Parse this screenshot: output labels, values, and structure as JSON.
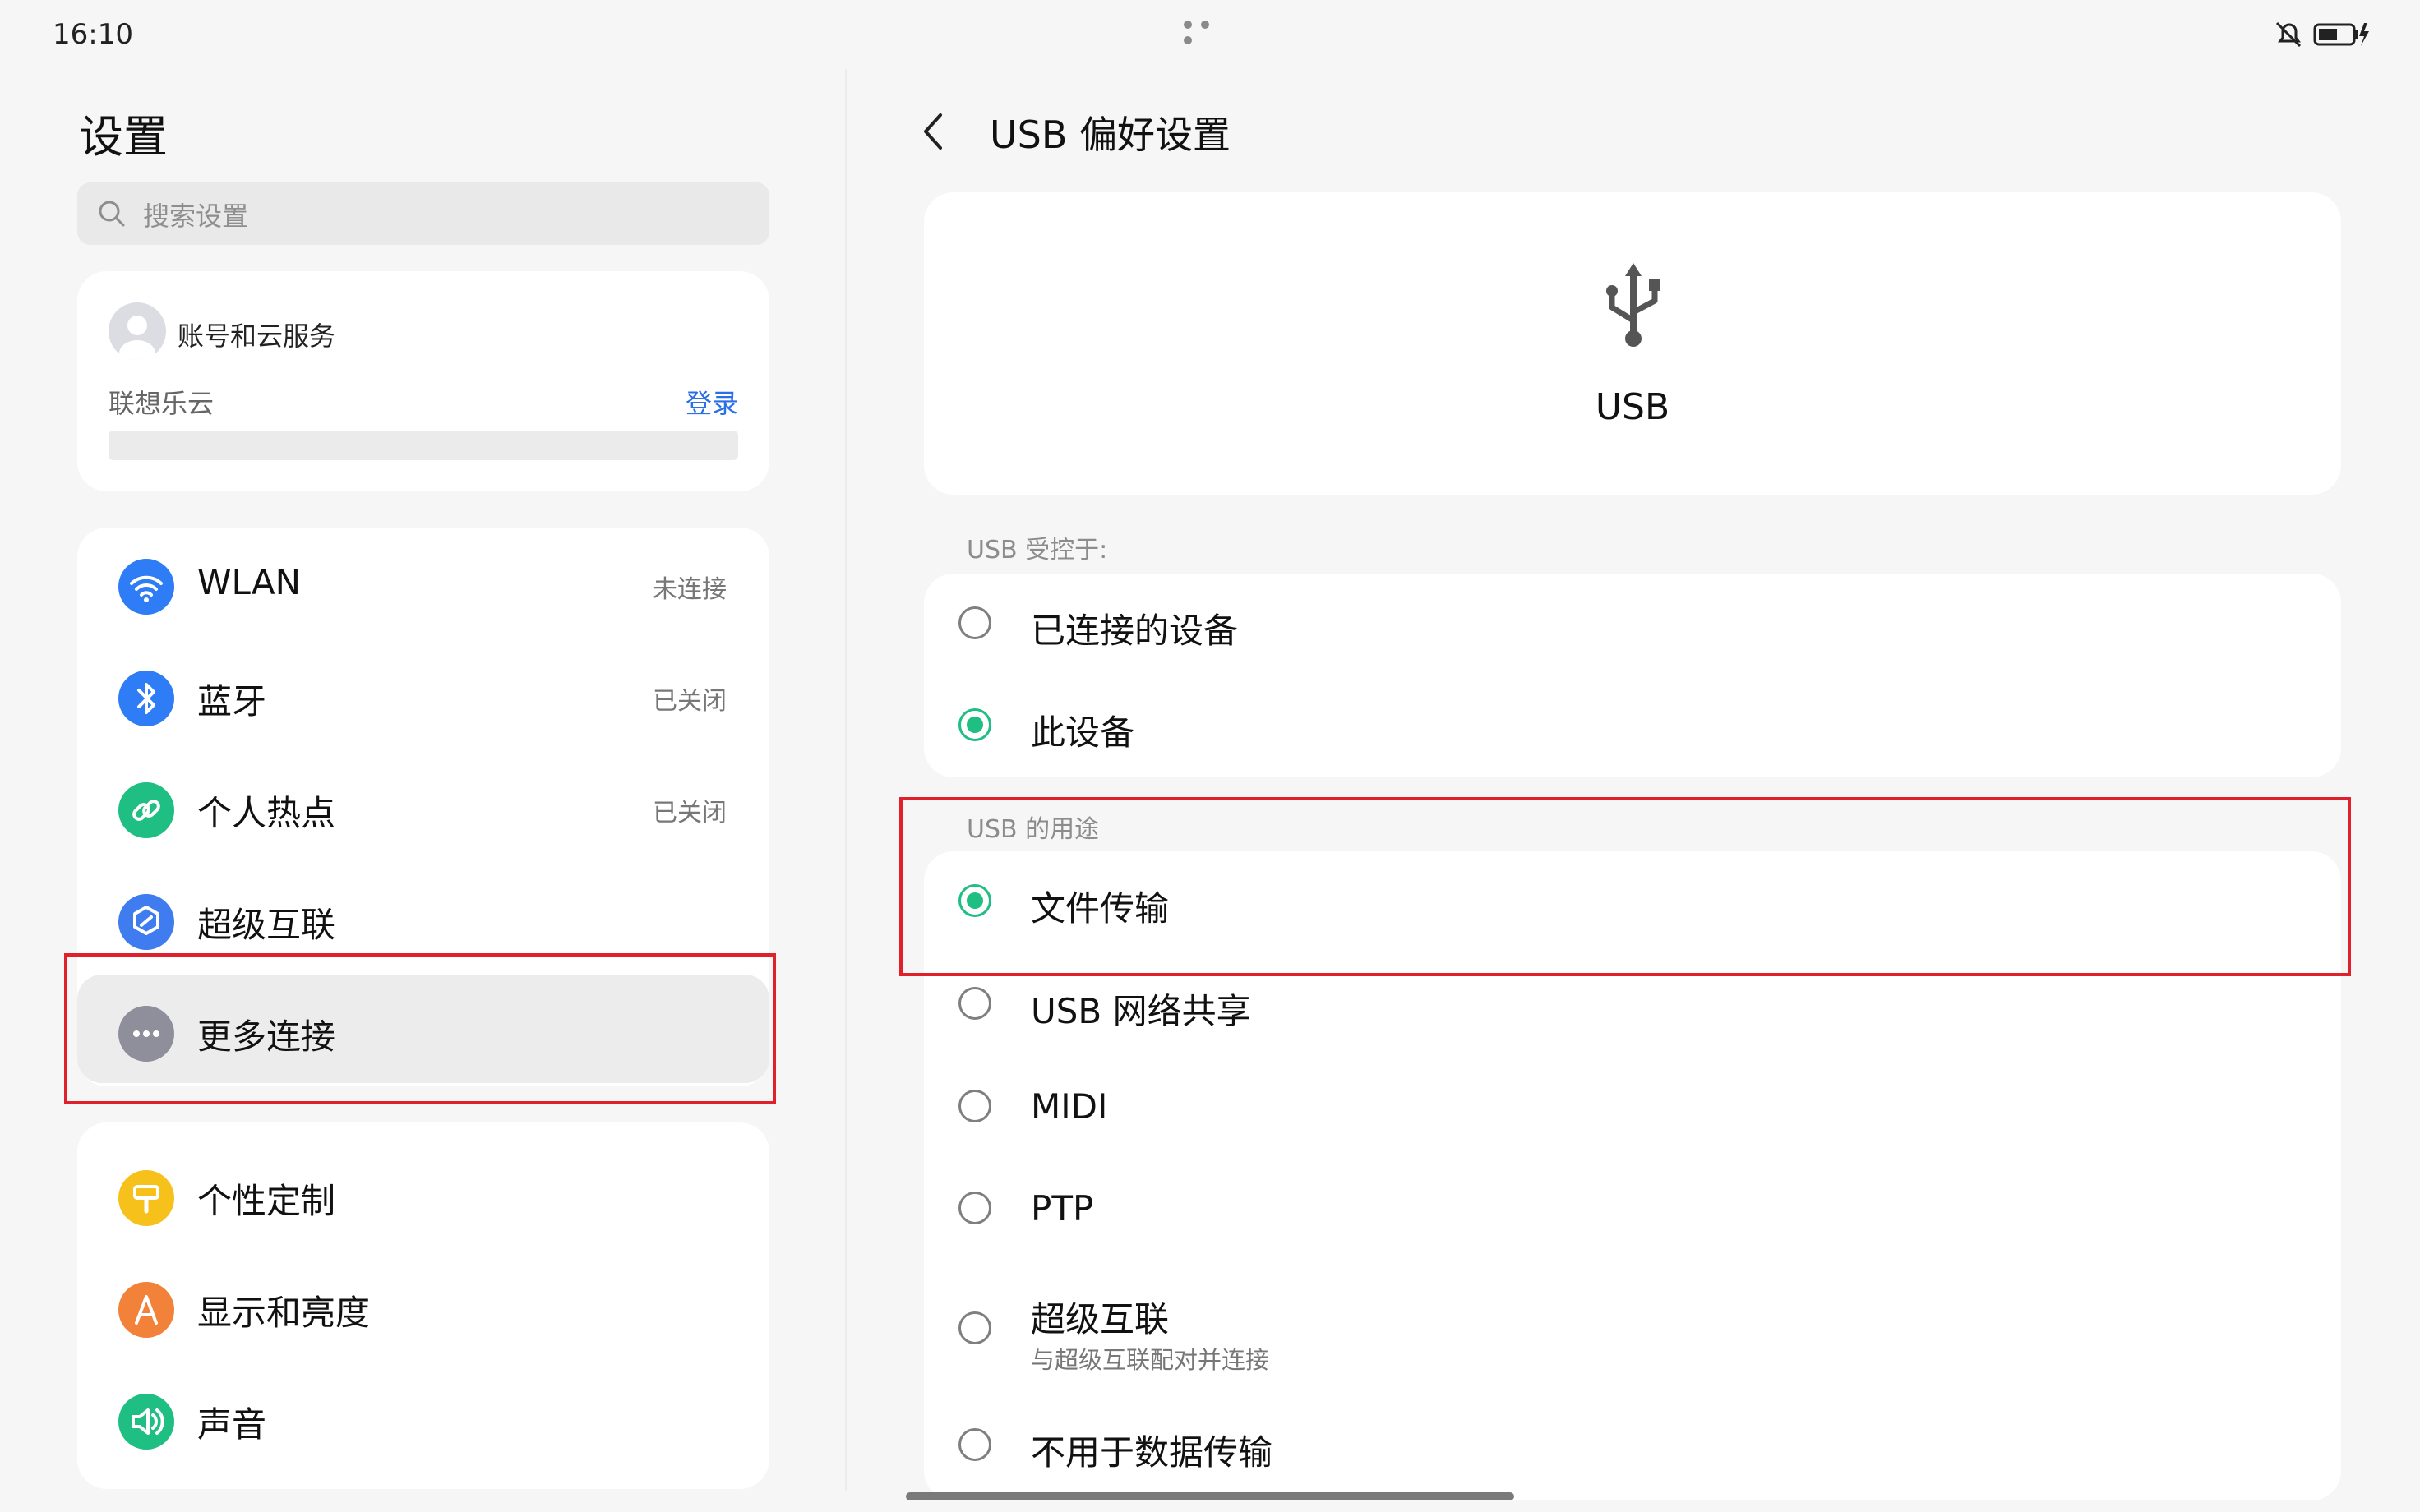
{
  "status_bar": {
    "time": "16:10"
  },
  "left": {
    "title": "设置",
    "search_placeholder": "搜索设置",
    "account": {
      "title": "账号和云服务",
      "cloud_label": "联想乐云",
      "login": "登录"
    },
    "connections": [
      {
        "label": "WLAN",
        "status": "未连接",
        "icon": "wifi-icon",
        "color": "#2e7cf6"
      },
      {
        "label": "蓝牙",
        "status": "已关闭",
        "icon": "bluetooth-icon",
        "color": "#2e7cf6"
      },
      {
        "label": "个人热点",
        "status": "已关闭",
        "icon": "hotspot-icon",
        "color": "#1fbe83"
      },
      {
        "label": "超级互联",
        "status": "",
        "icon": "super-link-icon",
        "color": "#3e7cf0"
      },
      {
        "label": "更多连接",
        "status": "",
        "icon": "more-icon",
        "color": "#8f8f9c"
      }
    ],
    "personal": [
      {
        "label": "个性定制",
        "icon": "customize-icon",
        "color": "#f7c11c"
      },
      {
        "label": "显示和亮度",
        "icon": "display-icon",
        "color": "#f2813a"
      },
      {
        "label": "声音",
        "icon": "sound-icon",
        "color": "#1fbe83"
      }
    ]
  },
  "right": {
    "title": "USB 偏好设置",
    "usb_label": "USB",
    "controlled_by_label": "USB 受控于:",
    "controlled_by": [
      {
        "label": "已连接的设备",
        "selected": false
      },
      {
        "label": "此设备",
        "selected": true
      }
    ],
    "purpose_label": "USB 的用途",
    "purposes": [
      {
        "label": "文件传输",
        "sub": "",
        "selected": true
      },
      {
        "label": "USB 网络共享",
        "sub": "",
        "selected": false
      },
      {
        "label": "MIDI",
        "sub": "",
        "selected": false
      },
      {
        "label": "PTP",
        "sub": "",
        "selected": false
      },
      {
        "label": "超级互联",
        "sub": "与超级互联配对并连接",
        "selected": false
      },
      {
        "label": "不用于数据传输",
        "sub": "",
        "selected": false
      }
    ]
  },
  "colors": {
    "accent_green": "#1fbe83",
    "link_blue": "#2a6fe6",
    "highlight_red": "#e0202a"
  }
}
